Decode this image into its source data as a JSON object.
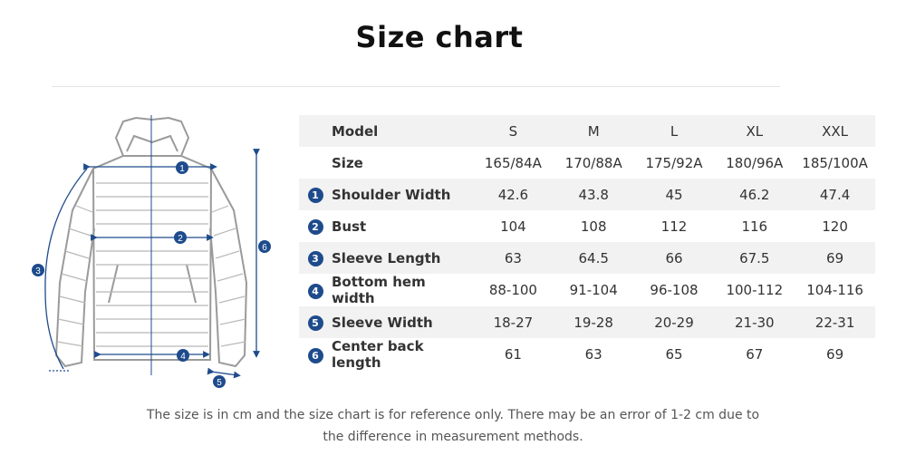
{
  "title": "Size chart",
  "table": {
    "header": {
      "label": "Model",
      "cols": [
        "S",
        "M",
        "L",
        "XL",
        "XXL"
      ]
    },
    "rows": [
      {
        "num": "",
        "label": "Size",
        "values": [
          "165/84A",
          "170/88A",
          "175/92A",
          "180/96A",
          "185/100A"
        ]
      },
      {
        "num": "1",
        "label": "Shoulder Width",
        "values": [
          "42.6",
          "43.8",
          "45",
          "46.2",
          "47.4"
        ]
      },
      {
        "num": "2",
        "label": "Bust",
        "values": [
          "104",
          "108",
          "112",
          "116",
          "120"
        ]
      },
      {
        "num": "3",
        "label": "Sleeve Length",
        "values": [
          "63",
          "64.5",
          "66",
          "67.5",
          "69"
        ]
      },
      {
        "num": "4",
        "label": "Bottom hem width",
        "values": [
          "88-100",
          "91-104",
          "96-108",
          "100-112",
          "104-116"
        ]
      },
      {
        "num": "5",
        "label": "Sleeve Width",
        "values": [
          "18-27",
          "19-28",
          "20-29",
          "21-30",
          "22-31"
        ]
      },
      {
        "num": "6",
        "label": "Center back length",
        "values": [
          "61",
          "63",
          "65",
          "67",
          "69"
        ]
      }
    ]
  },
  "diagram": {
    "markers": [
      "1",
      "2",
      "3",
      "4",
      "5",
      "6"
    ]
  },
  "note": "The size is in cm and the size chart is for reference only. There may be an error of 1-2 cm due to the difference in measurement methods.",
  "colors": {
    "accent": "#1e4b8c",
    "row_shade": "#f2f2f2",
    "jacket_line": "#9a9a9a"
  }
}
